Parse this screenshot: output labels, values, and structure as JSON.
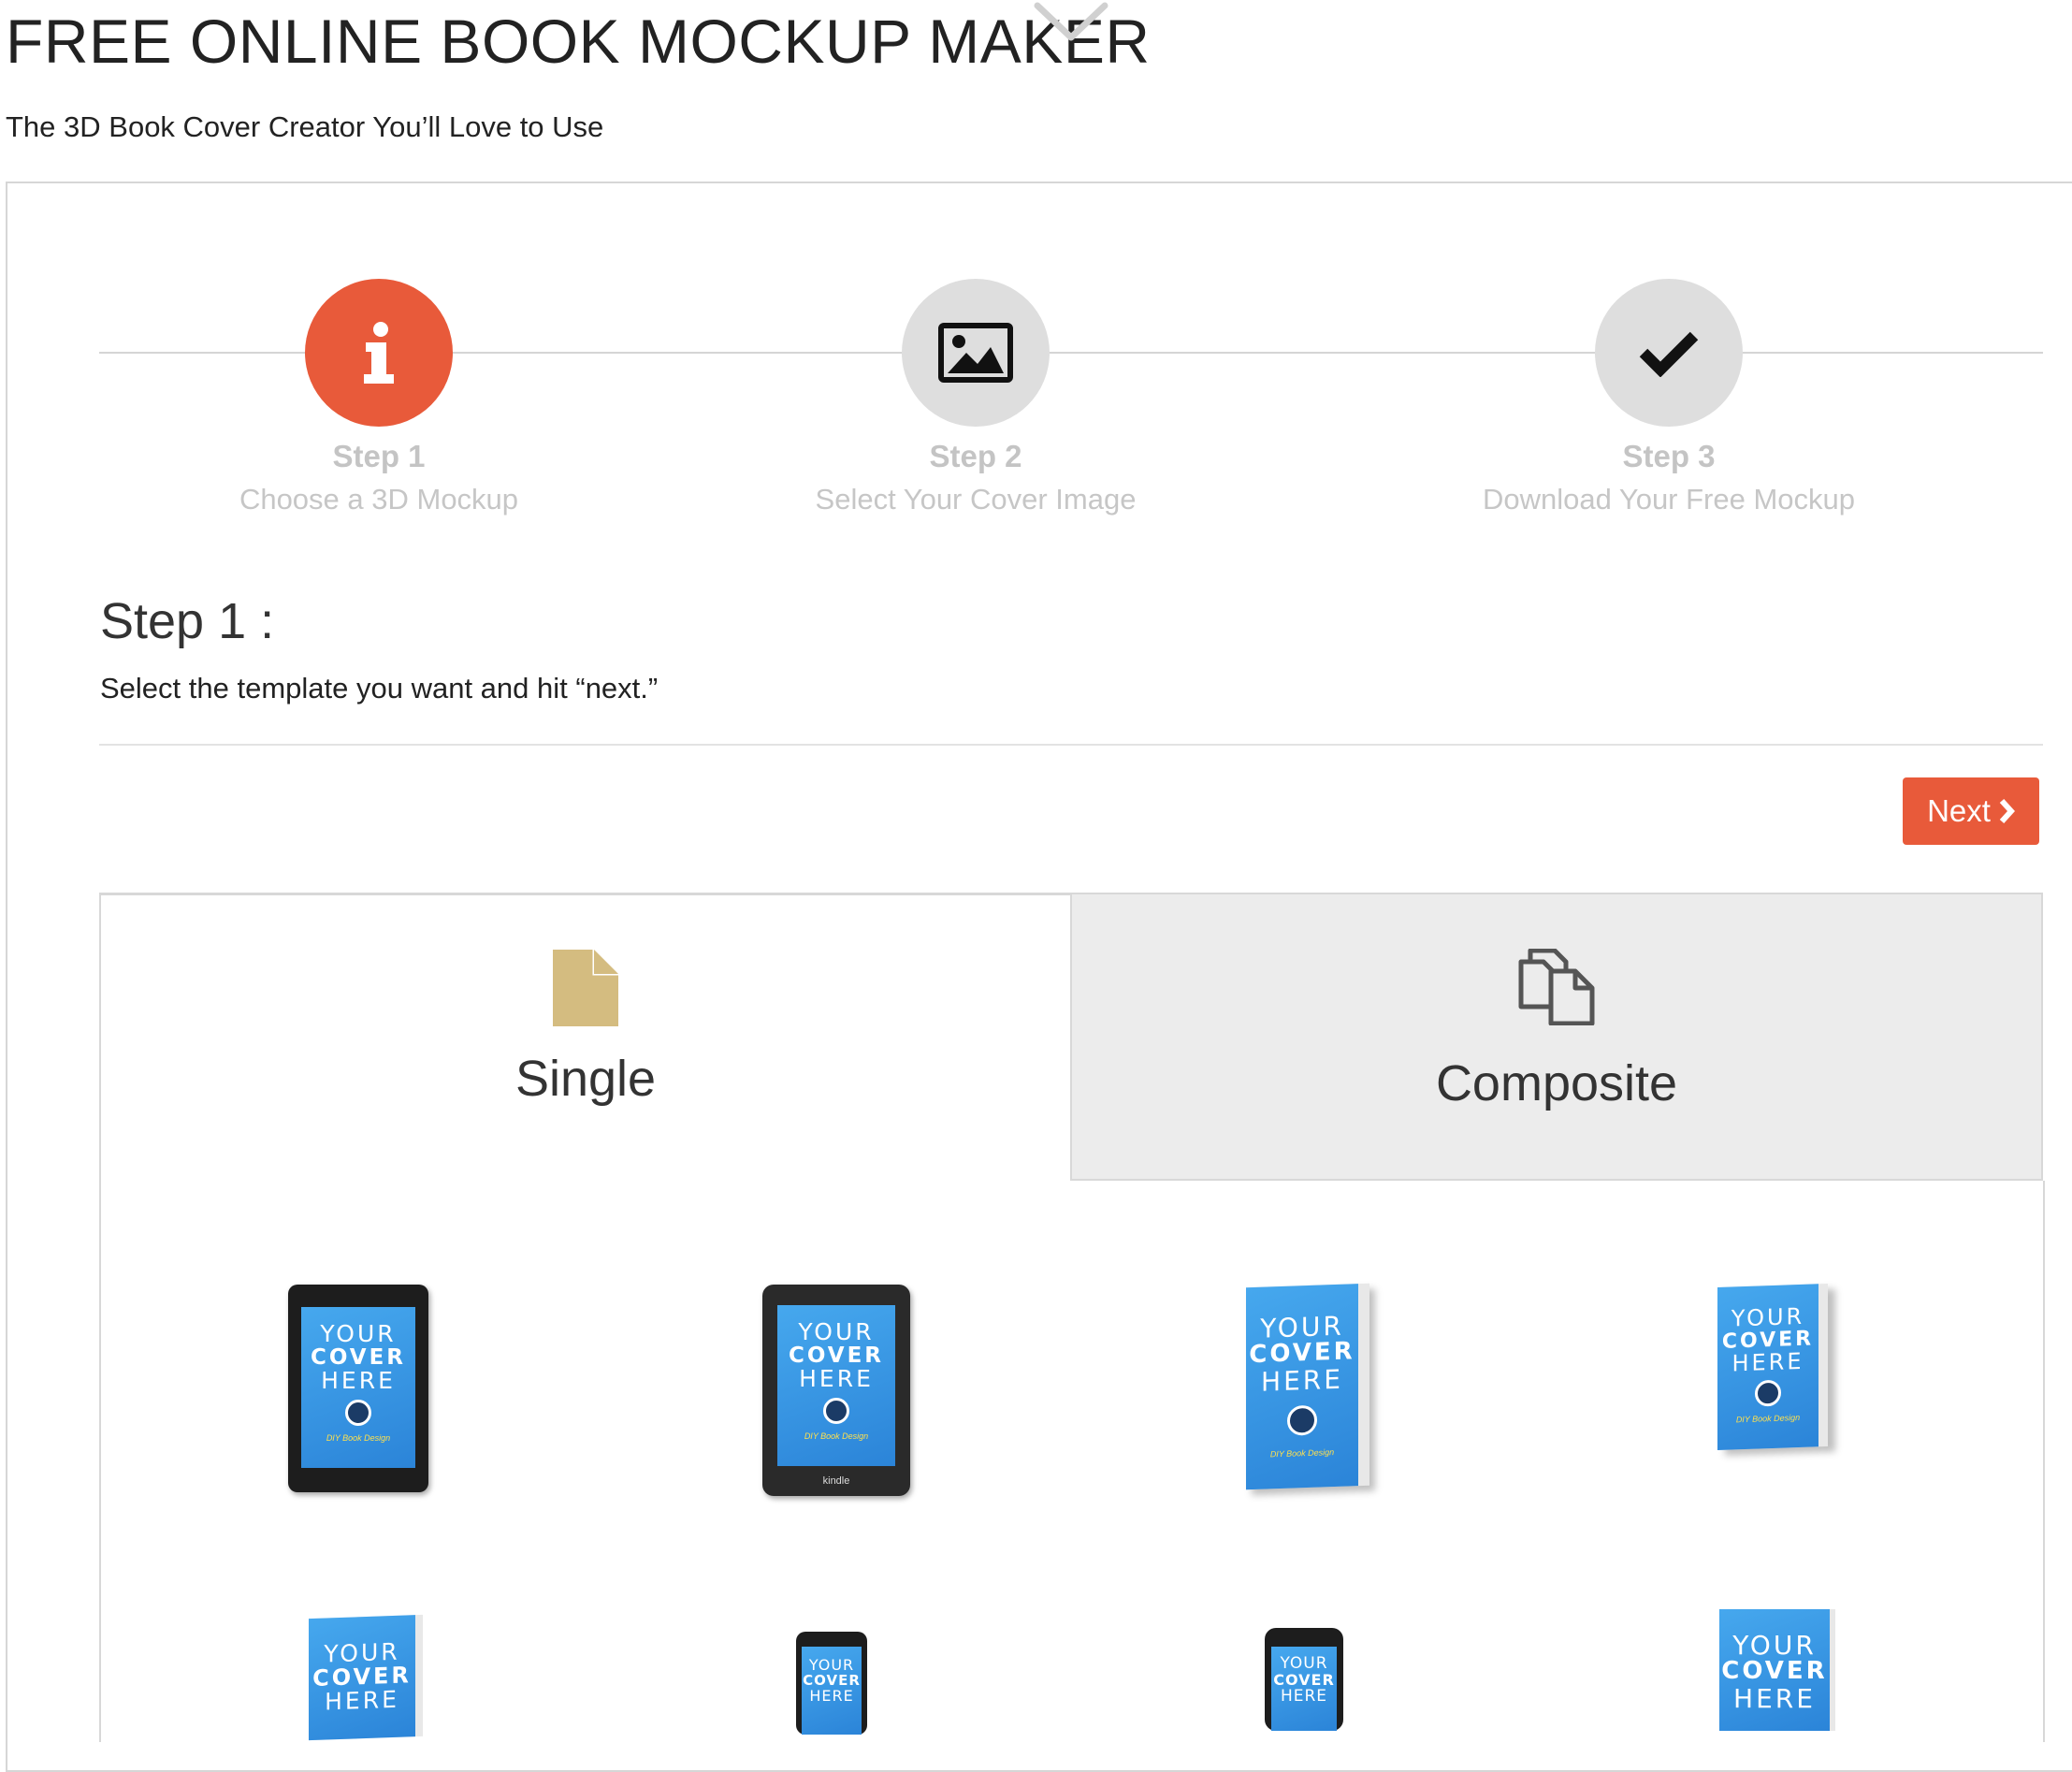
{
  "header": {
    "title": "FREE ONLINE BOOK MOCKUP MAKER",
    "subtitle": "The 3D Book Cover Creator You’ll Love to Use"
  },
  "steps": [
    {
      "number": "Step 1",
      "description": "Choose a 3D Mockup",
      "icon": "info-icon",
      "active": true
    },
    {
      "number": "Step 2",
      "description": "Select Your Cover Image",
      "icon": "image-icon",
      "active": false
    },
    {
      "number": "Step 3",
      "description": "Download Your Free Mockup",
      "icon": "checkmark-icon",
      "active": false
    }
  ],
  "section": {
    "heading": "Step 1 :",
    "instruction": "Select the template you want and hit “next.”"
  },
  "actions": {
    "next_label": "Next"
  },
  "tabs": [
    {
      "label": "Single",
      "icon": "single-file-icon",
      "selected": true
    },
    {
      "label": "Composite",
      "icon": "composite-files-icon",
      "selected": false
    }
  ],
  "mockup_cover": {
    "line1": "YOUR",
    "line2": "COVER",
    "line3": "HERE",
    "brand": "DIY Book Design",
    "kindle_label": "kindle"
  },
  "colors": {
    "accent": "#e85a3a",
    "step_inactive": "#dedede",
    "tab_icon": "#d4bc80",
    "cover_blue": "#3a97e4"
  }
}
